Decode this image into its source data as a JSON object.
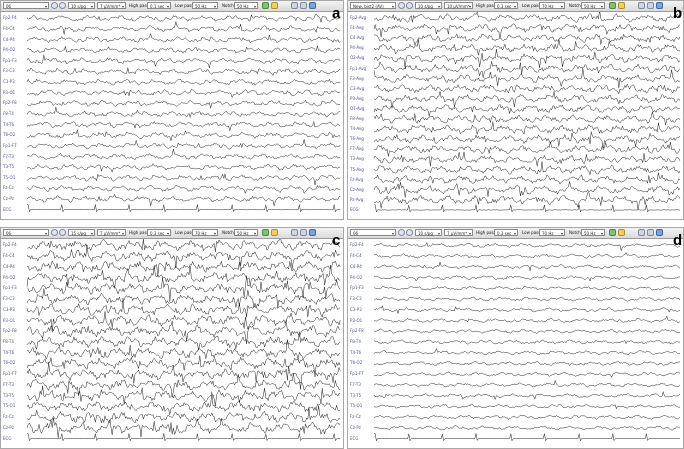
{
  "colors": {
    "trace": "#1a1a1a",
    "channel_label": "#4a4aa8",
    "toolbar": "#e4e4e4"
  },
  "panels": [
    {
      "letter": "a",
      "toolbar": {
        "montage": "06",
        "sensitivity": "10 s/pg",
        "gain": "7 µV/mm*",
        "high_pass_label": "High pass",
        "high_pass": "0.1 sec",
        "low_pass_label": "Low pass",
        "low_pass": "50 Hz",
        "notch_label": "Notch",
        "notch": "50 Hz"
      },
      "channels": [
        "Fp2-F4",
        "F4-C4",
        "C4-P4",
        "P4-O2",
        "Fp1-F3",
        "F3-C3",
        "C3-P3",
        "P3-O1",
        "Fp2-F8",
        "F8-T4",
        "T4-T6",
        "T6-O2",
        "Fp1-F7",
        "F7-T3",
        "T3-T5",
        "T5-O1",
        "Fz-Cz",
        "Cz-Pz",
        "ECG"
      ]
    },
    {
      "letter": "b",
      "toolbar": {
        "montage": "New, bist2 (AV)",
        "sensitivity": "10 s/pg",
        "gain": "10 µV/mm*",
        "high_pass_label": "High pass",
        "high_pass": "0.3 sec",
        "low_pass_label": "Low pass",
        "low_pass": "70 Hz",
        "notch_label": "Notch",
        "notch": "50 Hz"
      },
      "channels": [
        "Fp2-Avg",
        "F4-Avg",
        "C4-Avg",
        "P4-Avg",
        "O2-Avg",
        "Fp1-Avg",
        "F3-Avg",
        "C3-Avg",
        "P3-Avg",
        "O1-Avg",
        "F8-Avg",
        "T4-Avg",
        "T6-Avg",
        "F7-Avg",
        "T3-Avg",
        "T5-Avg",
        "Fz-Avg",
        "Cz-Avg",
        "Pz-Avg",
        "ECG"
      ]
    },
    {
      "letter": "c",
      "toolbar": {
        "montage": "06",
        "sensitivity": "15 s/pg",
        "gain": "7 µV/mm*",
        "high_pass_label": "High pass",
        "high_pass": "0.3 sec",
        "low_pass_label": "Low pass",
        "low_pass": "70 Hz",
        "notch_label": "Notch",
        "notch": "50 Hz"
      },
      "channels": [
        "Fp2-F4",
        "F4-C4",
        "C4-P4",
        "P4-O2",
        "Fp1-F3",
        "F3-C3",
        "C3-P3",
        "P3-O1",
        "Fp2-F8",
        "F8-T4",
        "T4-T6",
        "T6-O2",
        "Fp1-F7",
        "F7-T3",
        "T3-T5",
        "T5-O1",
        "Fz-Cz",
        "Cz-Pz",
        "ECG"
      ]
    },
    {
      "letter": "d",
      "toolbar": {
        "montage": "06",
        "sensitivity": "10 s/pg",
        "gain": "7 µV/mm*",
        "high_pass_label": "High pass",
        "high_pass": "0.3 sec",
        "low_pass_label": "Low pass",
        "low_pass": "70 Hz",
        "notch_label": "Notch",
        "notch": "50 Hz"
      },
      "channels": [
        "Fp2-F4",
        "F4-C4",
        "C4-P4",
        "P4-O2",
        "Fp1-F3",
        "F3-C3",
        "C3-P3",
        "P3-O1",
        "Fp2-F8",
        "F8-T4",
        "T4-T6",
        "T6-O2",
        "Fp1-F7",
        "F7-T3",
        "T3-T5",
        "T5-O1",
        "Fz-Cz",
        "Cz-Pz",
        "ECG"
      ]
    }
  ]
}
